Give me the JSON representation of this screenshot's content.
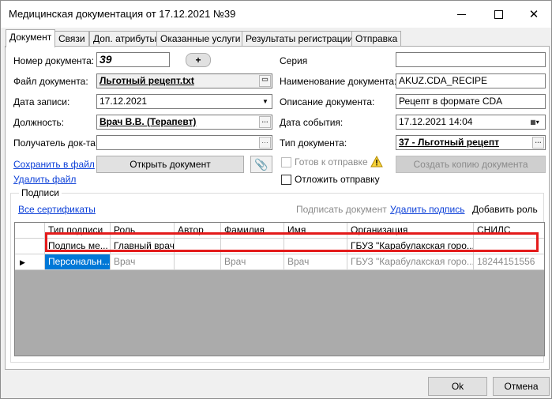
{
  "window": {
    "title": "Медицинская документация от 17.12.2021 №39"
  },
  "tabs": [
    "Документ",
    "Связи",
    "Доп. атрибуты",
    "Оказанные услуги",
    "Результаты регистрации",
    "Отправка"
  ],
  "form": {
    "doc_number_label": "Номер документа:",
    "doc_number": "39",
    "add_button": "+",
    "file_label": "Файл документа:",
    "file": "Льготный рецепт.txt",
    "record_date_label": "Дата записи:",
    "record_date": "17.12.2021",
    "position_label": "Должность:",
    "position": "Врач В.В. (Терапевт)",
    "recipient_label": "Получатель док-та",
    "recipient": "",
    "save_file_link": "Сохранить в файл",
    "delete_file_link": "Удалить файл",
    "open_doc_button": "Открыть документ",
    "series_label": "Серия",
    "series": "",
    "doc_name_label": "Наименование документа:",
    "doc_name": "AKUZ.CDA_RECIPE",
    "doc_desc_label": "Описание документа:",
    "doc_desc": "Рецепт в формате CDA",
    "event_date_label": "Дата события:",
    "event_date": "17.12.2021 14:04",
    "doc_type_label": "Тип документа:",
    "doc_type": "37 - Льготный рецепт",
    "ready_to_send": "Готов к отправке",
    "create_copy_button": "Создать копию документа",
    "postpone_send": "Отложить отправку"
  },
  "signatures": {
    "group_title": "Подписи",
    "all_certs_link": "Все сертификаты",
    "sign_doc": "Подписать документ",
    "delete_sign_link": "Удалить подпись",
    "add_role_button": "Добавить роль",
    "columns": [
      "Тип подписи",
      "Роль",
      "Автор",
      "Фамилия",
      "Имя",
      "Организация",
      "СНИЛС"
    ],
    "rows": [
      [
        "Подпись ме...",
        "Главный врач",
        "",
        "",
        "",
        "ГБУЗ \"Карабулакская горо...",
        ""
      ],
      [
        "Персональн...",
        "Врач",
        "",
        "Врач",
        "Врач",
        "ГБУЗ \"Карабулакская горо...",
        "18244151556"
      ]
    ]
  },
  "footer": {
    "ok": "Ok",
    "cancel": "Отмена"
  },
  "colors": {
    "accent": "#0078d7",
    "highlight": "#e41b1b",
    "link": "#0b3fd8"
  }
}
